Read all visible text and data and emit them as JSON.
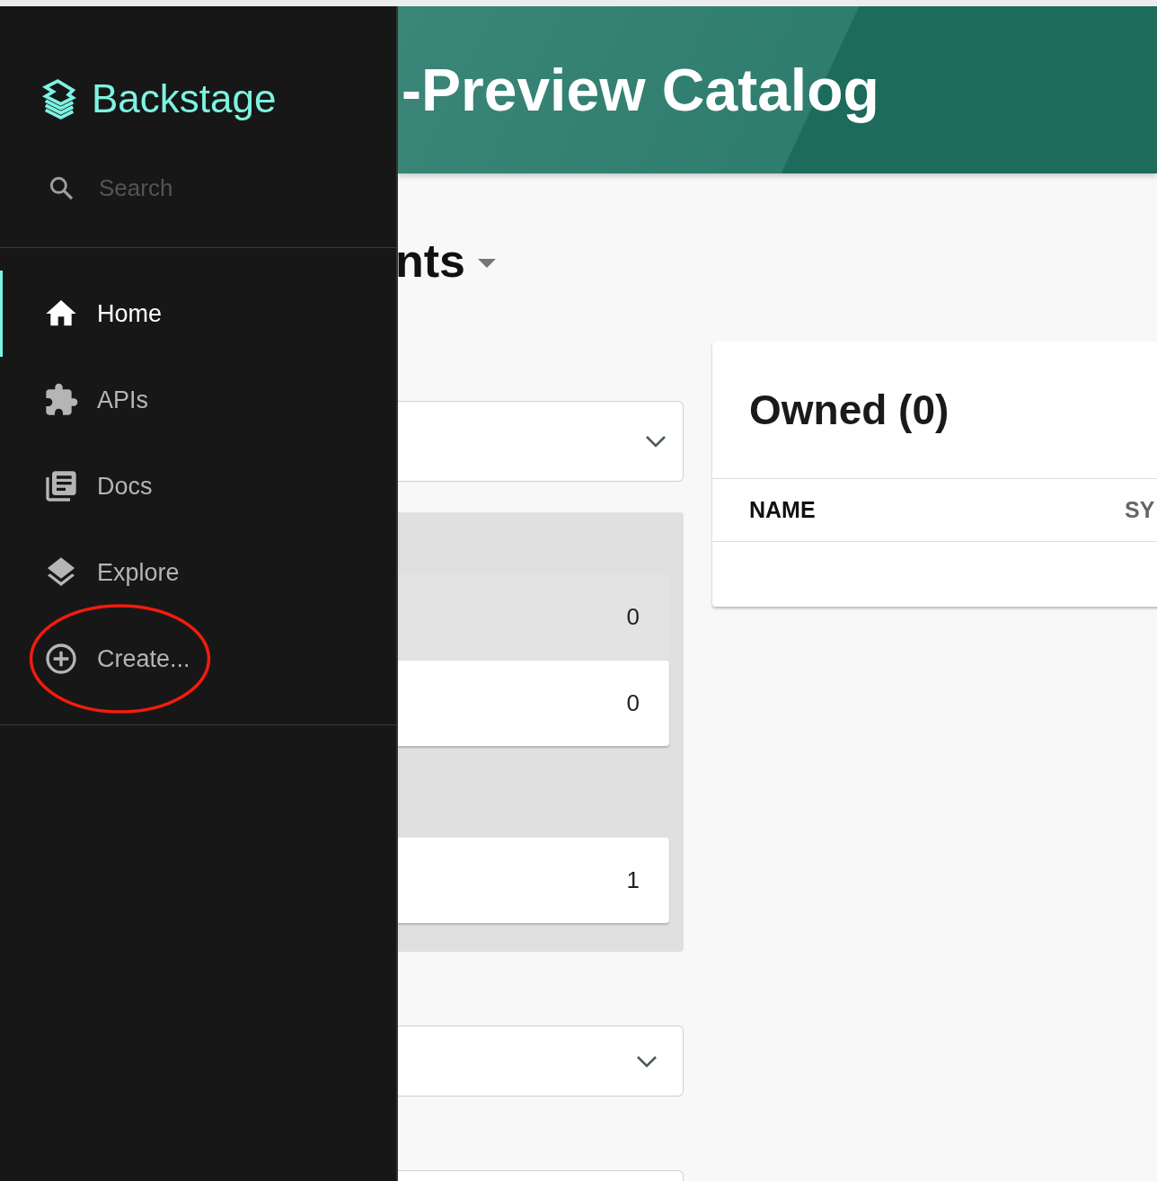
{
  "sidebar": {
    "logo": "Backstage",
    "search": {
      "placeholder": "Search"
    },
    "items": [
      {
        "label": "Home",
        "selected": true,
        "circled": false
      },
      {
        "label": "APIs",
        "selected": false,
        "circled": false
      },
      {
        "label": "Docs",
        "selected": false,
        "circled": false
      },
      {
        "label": "Explore",
        "selected": false,
        "circled": false
      },
      {
        "label": "Create...",
        "selected": false,
        "circled": true
      }
    ]
  },
  "header": {
    "title": "-Preview Catalog"
  },
  "page_heading": "nts",
  "filters": [
    {
      "kind": "select",
      "chevron": true
    },
    {
      "kind": "group_panel",
      "groups": [
        {
          "rows": [
            {
              "count": "0",
              "selected": true
            },
            {
              "count": "0",
              "selected": false
            }
          ]
        },
        {
          "rows": [
            {
              "count": "1",
              "selected": false
            }
          ]
        }
      ]
    },
    {
      "kind": "select",
      "chevron": true
    },
    {
      "kind": "select"
    }
  ],
  "owned_card": {
    "title": "Owned (0)",
    "columns": [
      "NAME",
      "SY"
    ]
  }
}
